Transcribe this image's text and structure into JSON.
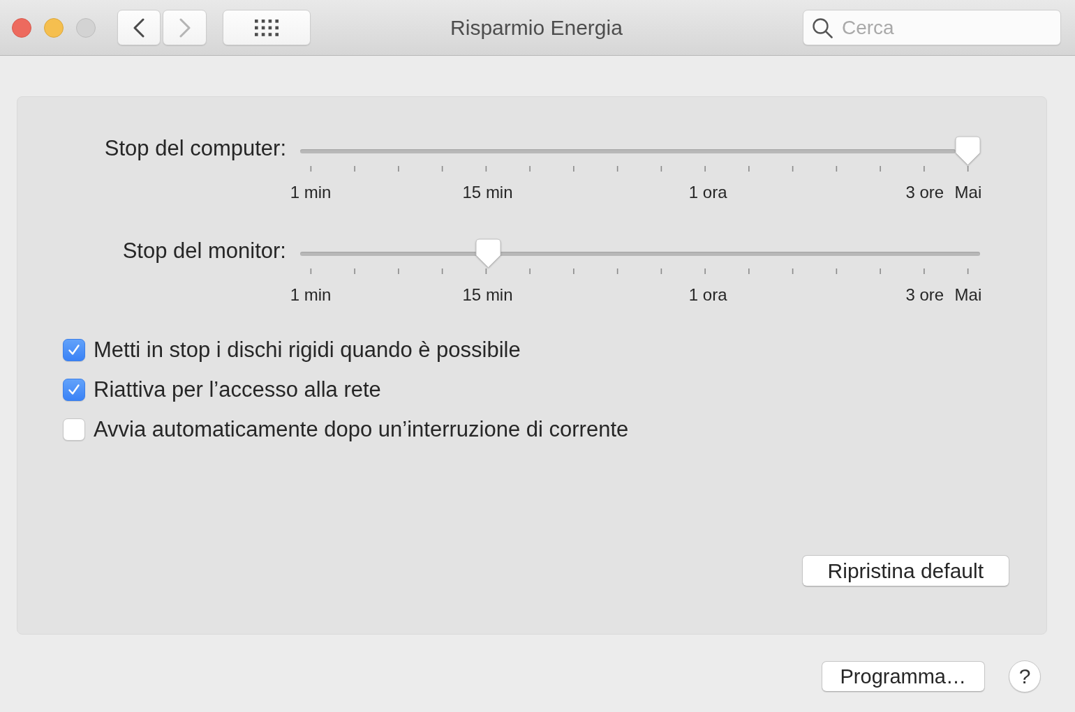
{
  "window": {
    "title": "Risparmio Energia"
  },
  "toolbar": {
    "back": {
      "disabled": false
    },
    "forward": {
      "disabled": true
    },
    "search": {
      "placeholder": "Cerca"
    }
  },
  "sliders": [
    {
      "label": "Stop del computer:",
      "level": 1,
      "scale": [
        "1 min",
        "15 min",
        "1 ora",
        "3 ore",
        "Mai"
      ]
    },
    {
      "label": "Stop del monitor:",
      "level": 0.27,
      "scale": [
        "1 min",
        "15 min",
        "1 ora",
        "3 ore",
        "Mai"
      ]
    }
  ],
  "checkboxes": [
    {
      "label": "Metti in stop i dischi rigidi quando è possibile",
      "checked": true
    },
    {
      "label": "Riattiva per l’accesso alla rete",
      "checked": true
    },
    {
      "label": "Avvia automaticamente dopo un’interruzione di corrente",
      "checked": false
    }
  ],
  "restore_button": "Ripristina default",
  "footer": {
    "schedule_button": "Programma…",
    "help_button": "?"
  }
}
